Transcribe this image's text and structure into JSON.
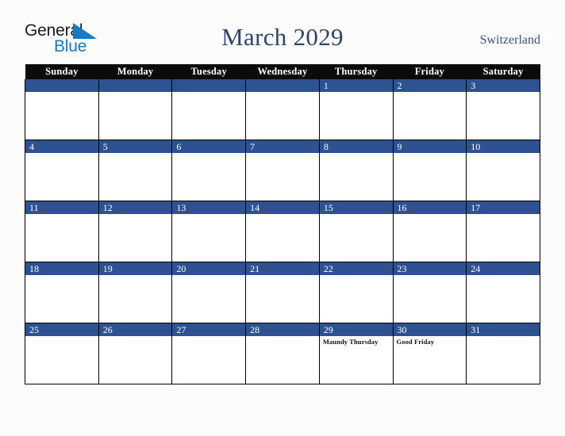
{
  "header": {
    "logo": {
      "word_one": "General",
      "word_two": "Blue",
      "triangle_icon": "triangle-icon",
      "word_one_color": "#1b1b1b",
      "word_two_color": "#1779c4",
      "triangle_color": "#1779c4"
    },
    "title": "March 2029",
    "region": "Switzerland",
    "title_color": "#2e4372",
    "region_color": "#3b5080"
  },
  "calendar": {
    "month": "March",
    "year": "2029",
    "weekday_headers": [
      "Sunday",
      "Monday",
      "Tuesday",
      "Wednesday",
      "Thursday",
      "Friday",
      "Saturday"
    ],
    "header_bg_color": "#0b0b0b",
    "date_bar_color": "#2e5291",
    "cell_bg_color": "#ffffff",
    "grid_line_color": "#000000",
    "weeks": [
      [
        {
          "date": "",
          "holiday": ""
        },
        {
          "date": "",
          "holiday": ""
        },
        {
          "date": "",
          "holiday": ""
        },
        {
          "date": "",
          "holiday": ""
        },
        {
          "date": "1",
          "holiday": ""
        },
        {
          "date": "2",
          "holiday": ""
        },
        {
          "date": "3",
          "holiday": ""
        }
      ],
      [
        {
          "date": "4",
          "holiday": ""
        },
        {
          "date": "5",
          "holiday": ""
        },
        {
          "date": "6",
          "holiday": ""
        },
        {
          "date": "7",
          "holiday": ""
        },
        {
          "date": "8",
          "holiday": ""
        },
        {
          "date": "9",
          "holiday": ""
        },
        {
          "date": "10",
          "holiday": ""
        }
      ],
      [
        {
          "date": "11",
          "holiday": ""
        },
        {
          "date": "12",
          "holiday": ""
        },
        {
          "date": "13",
          "holiday": ""
        },
        {
          "date": "14",
          "holiday": ""
        },
        {
          "date": "15",
          "holiday": ""
        },
        {
          "date": "16",
          "holiday": ""
        },
        {
          "date": "17",
          "holiday": ""
        }
      ],
      [
        {
          "date": "18",
          "holiday": ""
        },
        {
          "date": "19",
          "holiday": ""
        },
        {
          "date": "20",
          "holiday": ""
        },
        {
          "date": "21",
          "holiday": ""
        },
        {
          "date": "22",
          "holiday": ""
        },
        {
          "date": "23",
          "holiday": ""
        },
        {
          "date": "24",
          "holiday": ""
        }
      ],
      [
        {
          "date": "25",
          "holiday": ""
        },
        {
          "date": "26",
          "holiday": ""
        },
        {
          "date": "27",
          "holiday": ""
        },
        {
          "date": "28",
          "holiday": ""
        },
        {
          "date": "29",
          "holiday": "Maundy Thursday"
        },
        {
          "date": "30",
          "holiday": "Good Friday"
        },
        {
          "date": "31",
          "holiday": ""
        }
      ]
    ]
  }
}
